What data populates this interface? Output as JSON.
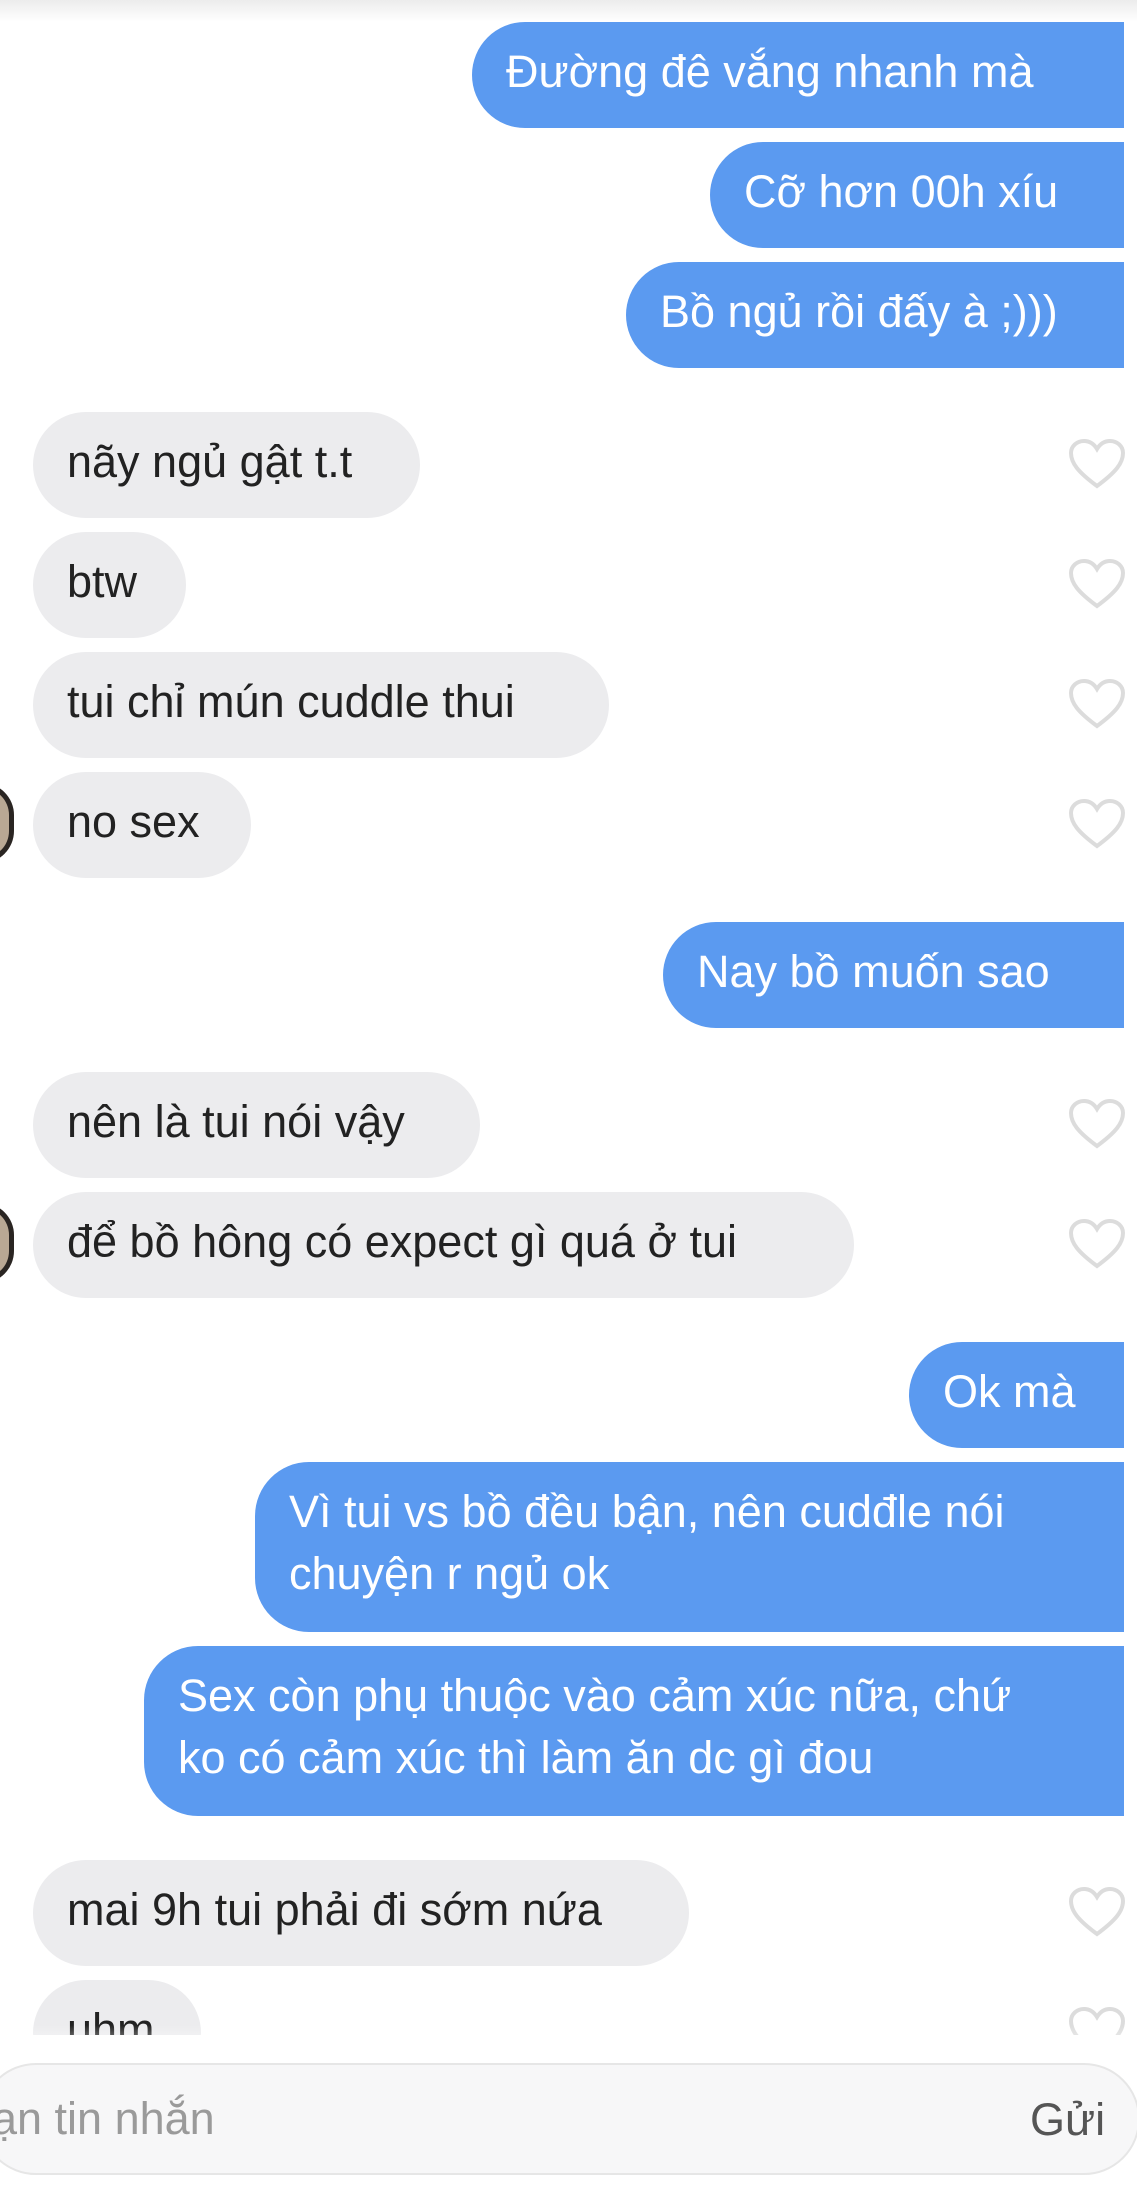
{
  "messages": [
    {
      "dir": "sent",
      "text": "Đường đê vắng nhanh mà"
    },
    {
      "dir": "sent",
      "text": "Cỡ hơn 00h xíu"
    },
    {
      "dir": "sent",
      "text": "Bồ ngủ rồi đấy à ;)))"
    },
    {
      "dir": "recv",
      "text": "nãy ngủ gật t.t"
    },
    {
      "dir": "recv",
      "text": "btw"
    },
    {
      "dir": "recv",
      "text": "tui chỉ mún cuddle thui"
    },
    {
      "dir": "recv",
      "text": "no sex"
    },
    {
      "dir": "sent",
      "text": "Nay bồ muốn sao"
    },
    {
      "dir": "recv",
      "text": "nên là tui nói vậy"
    },
    {
      "dir": "recv",
      "text": "để bồ hông có expect gì quá ở tui"
    },
    {
      "dir": "sent",
      "text": "Ok mà"
    },
    {
      "dir": "sent",
      "line1": "Vì tui vs bồ đều bận, nên cudđle nói",
      "line2": "chuyện r ngủ ok"
    },
    {
      "dir": "sent",
      "line1": "Sex còn phụ thuộc vào cảm xúc nữa, chứ",
      "line2": "ko có cảm xúc thì làm ăn dc gì đou"
    },
    {
      "dir": "recv",
      "text": "mai 9h tui phải đi sớm nứa"
    },
    {
      "dir": "recv",
      "text": "uhm"
    }
  ],
  "composer": {
    "placeholder": "ạn tin nhắn",
    "send_label": "Gửi"
  },
  "colors": {
    "sent_bubble": "#5b9af0",
    "received_bubble": "#ececee",
    "heart_outline": "#dcdcdc"
  },
  "icons": {
    "like": "heart-outline-icon",
    "avatar": "avatar"
  }
}
